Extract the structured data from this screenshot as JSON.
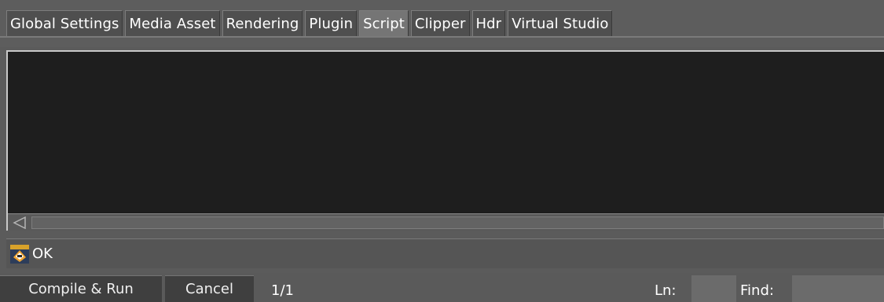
{
  "tabs": [
    {
      "label": "Global Settings",
      "active": false
    },
    {
      "label": "Media Asset",
      "active": false
    },
    {
      "label": "Rendering",
      "active": false
    },
    {
      "label": "Plugin",
      "active": false
    },
    {
      "label": "Script",
      "active": true
    },
    {
      "label": "Clipper",
      "active": false
    },
    {
      "label": "Hdr",
      "active": false
    },
    {
      "label": "Virtual Studio",
      "active": false
    }
  ],
  "editor": {
    "content": ""
  },
  "scrollbar": {
    "left_arrow_icon": "triangle-left-icon"
  },
  "status": {
    "icon": "script-status-icon",
    "text": "OK"
  },
  "bottom": {
    "compile_label": "Compile & Run",
    "cancel_label": "Cancel",
    "page_indicator": "1/1",
    "ln_label": "Ln:",
    "ln_value": "",
    "find_label": "Find:",
    "find_value": ""
  },
  "colors": {
    "background": "#5b5b5b",
    "editor_background": "#1e1e1e",
    "tab_active": "#757575",
    "tab_inactive": "#4f4f4f",
    "button": "#3f3f3f"
  }
}
